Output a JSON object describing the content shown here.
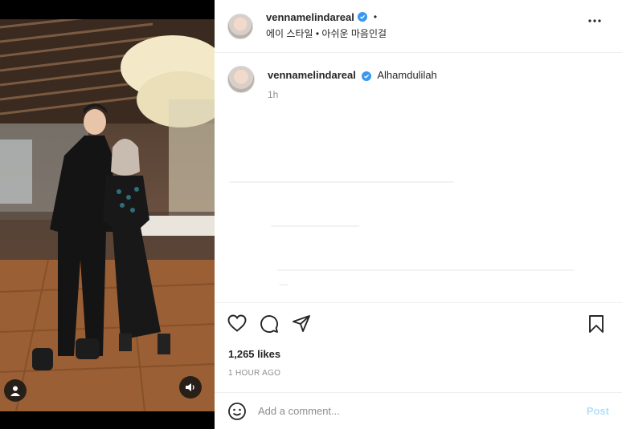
{
  "header": {
    "username": "vennamelindareal",
    "separator": "•",
    "subtitle": "에이 스타일 • 아쉬운 마음인걸"
  },
  "caption": {
    "username": "vennamelindareal",
    "text": "Alhamdulilah",
    "time": "1h"
  },
  "stats": {
    "likes": "1,265 likes",
    "posted": "1 HOUR AGO"
  },
  "comment": {
    "placeholder": "Add a comment...",
    "post_label": "Post"
  },
  "icons": {
    "verified": "verified-badge-icon",
    "more": "more-options-icon",
    "like": "heart-icon",
    "comment": "comment-bubble-icon",
    "share": "paper-plane-icon",
    "save": "bookmark-icon",
    "emoji": "emoji-icon",
    "tag": "user-tag-icon",
    "sound": "speaker-icon"
  },
  "colors": {
    "verified": "#3897f0",
    "post_disabled": "#b2dffc",
    "muted_text": "#8e8e8e"
  }
}
